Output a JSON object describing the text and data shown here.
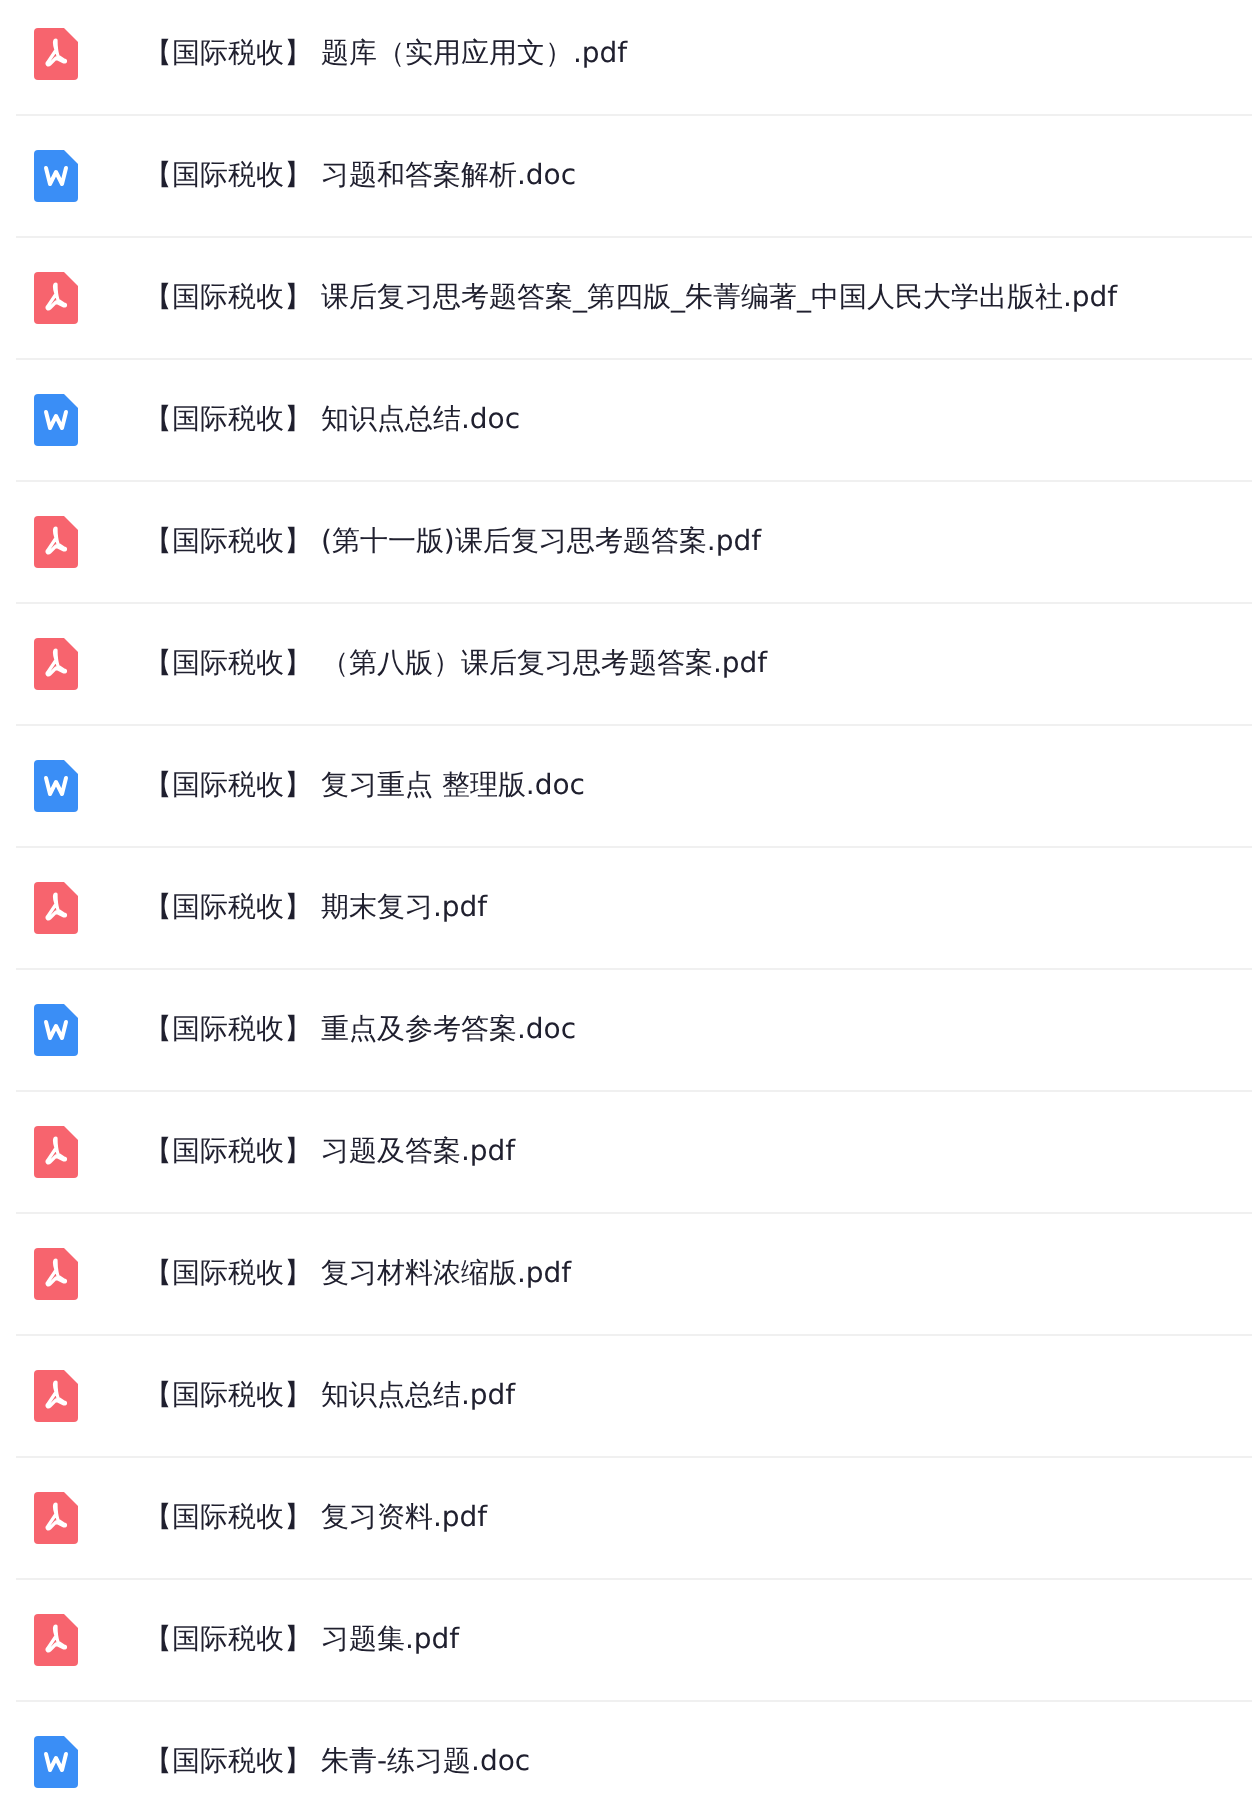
{
  "files": [
    {
      "kind": "pdf",
      "name": "【国际税收】 题库（实用应用文）.pdf"
    },
    {
      "kind": "doc",
      "name": "【国际税收】 习题和答案解析.doc"
    },
    {
      "kind": "pdf",
      "name": "【国际税收】 课后复习思考题答案_第四版_朱菁编著_中国人民大学出版社.pdf"
    },
    {
      "kind": "doc",
      "name": "【国际税收】 知识点总结.doc"
    },
    {
      "kind": "pdf",
      "name": "【国际税收】 (第十一版)课后复习思考题答案.pdf"
    },
    {
      "kind": "pdf",
      "name": "【国际税收】 （第八版）课后复习思考题答案.pdf"
    },
    {
      "kind": "doc",
      "name": "【国际税收】 复习重点 整理版.doc"
    },
    {
      "kind": "pdf",
      "name": "【国际税收】 期末复习.pdf"
    },
    {
      "kind": "doc",
      "name": "【国际税收】 重点及参考答案.doc"
    },
    {
      "kind": "pdf",
      "name": "【国际税收】 习题及答案.pdf"
    },
    {
      "kind": "pdf",
      "name": "【国际税收】 复习材料浓缩版.pdf"
    },
    {
      "kind": "pdf",
      "name": "【国际税收】 知识点总结.pdf"
    },
    {
      "kind": "pdf",
      "name": "【国际税收】 复习资料.pdf"
    },
    {
      "kind": "pdf",
      "name": "【国际税收】 习题集.pdf"
    },
    {
      "kind": "doc",
      "name": "【国际税收】 朱青-练习题.doc"
    }
  ]
}
